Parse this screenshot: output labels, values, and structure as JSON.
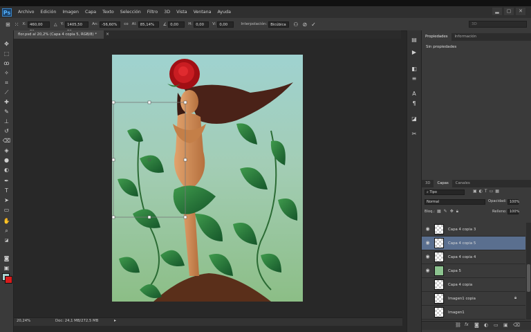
{
  "app": {
    "logo": "Ps"
  },
  "menu": [
    "Archivo",
    "Edición",
    "Imagen",
    "Capa",
    "Texto",
    "Selección",
    "Filtro",
    "3D",
    "Vista",
    "Ventana",
    "Ayuda"
  ],
  "window_controls": [
    "▂",
    "▢",
    "✕"
  ],
  "options": {
    "x_label": "X:",
    "x_value": "460,00 px",
    "y_label": "Y:",
    "y_value": "1405,50 px",
    "w_label": "An:",
    "w_value": "-56,60%",
    "link_label": "co",
    "h_label": "Al:",
    "h_value": "85,14%",
    "angle_value": "0,00",
    "hskew_label": "H:",
    "hskew_value": "0,00",
    "vskew_label": "V:",
    "vskew_value": "0,00",
    "interp_label": "Interpolación:",
    "interp_value": "Bicúbica",
    "search_3d": "3D"
  },
  "document": {
    "tab_title": "flor.psd al 20,2% (Capa 4 copia 5, RGB/8) *",
    "zoom": "20,24%",
    "doc_size": "Doc: 24,1 MB/272,5 MB"
  },
  "colors": {
    "foreground": "#a8d4d0",
    "background": "#d81c1c",
    "accent_selected": "#5a6f8f"
  },
  "properties_panel": {
    "tabs": [
      "Propiedades",
      "Información"
    ],
    "content": "Sin propiedades"
  },
  "layers_panel": {
    "tabs": [
      "3D",
      "Capas",
      "Canales"
    ],
    "filter_kind": "Tipo",
    "blend_mode": "Normal",
    "opacity_label": "Opacidad:",
    "opacity_value": "100%",
    "lock_label": "Bloq.:",
    "fill_label": "Relleno:",
    "fill_value": "100%",
    "layers": [
      {
        "name": "Capa 4 copia 3",
        "visible": true,
        "selected": false
      },
      {
        "name": "Capa 4 copia 5",
        "visible": true,
        "selected": true
      },
      {
        "name": "Capa 4 copia 4",
        "visible": true,
        "selected": false
      },
      {
        "name": "Capa 5",
        "visible": true,
        "selected": false
      },
      {
        "name": "Capa 4 copia",
        "visible": false,
        "selected": false
      },
      {
        "name": "Imagen1 copia",
        "visible": false,
        "selected": false,
        "locked": true
      },
      {
        "name": "Imagen1",
        "visible": false,
        "selected": false
      }
    ],
    "footer_icons": [
      "link-icon",
      "fx-icon",
      "mask-icon",
      "adjustment-icon",
      "folder-icon",
      "new-layer-icon",
      "trash-icon"
    ]
  }
}
